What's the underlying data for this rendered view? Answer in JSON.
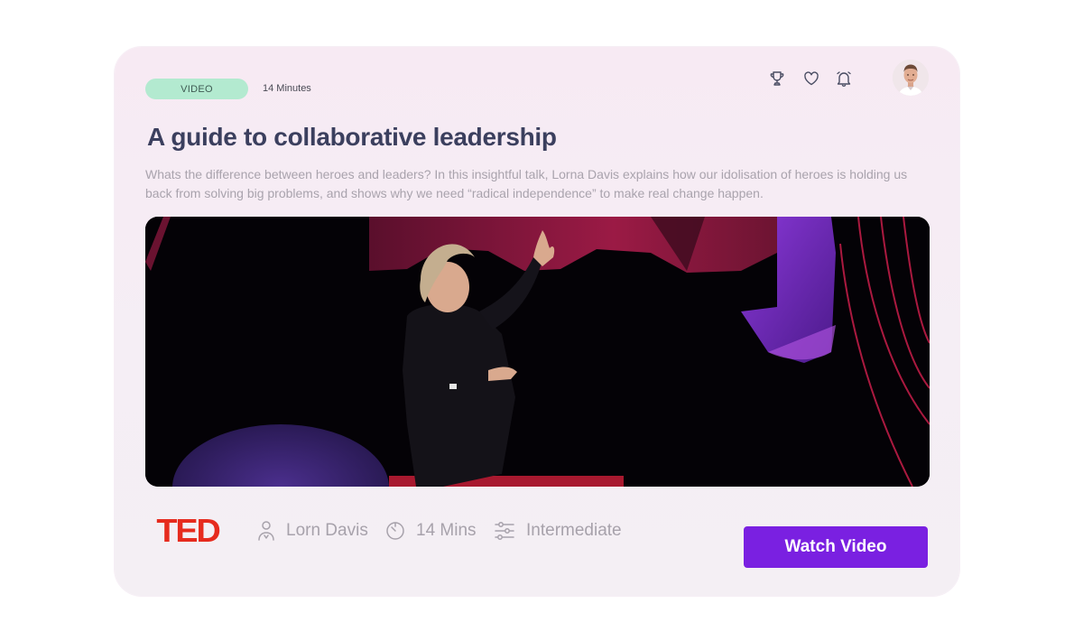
{
  "card": {
    "badge": "VIDEO",
    "duration": "14 Minutes",
    "title": "A guide to collaborative leadership",
    "description": "Whats the difference between heroes and leaders? In this insightful talk, Lorna Davis explains how our idolisation of heroes is holding us back from solving big problems, and shows why we need “radical independence” to make real change happen.",
    "header_icons": [
      "trophy-icon",
      "heart-icon",
      "bell-icon"
    ],
    "video": {
      "thumbnail": "speaker-on-stage"
    },
    "footer": {
      "brand_logo": "TED",
      "speaker": "Lorn Davis",
      "length": "14 Mins",
      "level": "Intermediate",
      "cta_label": "Watch Video"
    }
  },
  "colors": {
    "badge_bg": "#b3ead0",
    "title": "#3b3f5e",
    "cta_bg": "#7a20e1",
    "ted_red": "#e62b1e"
  }
}
